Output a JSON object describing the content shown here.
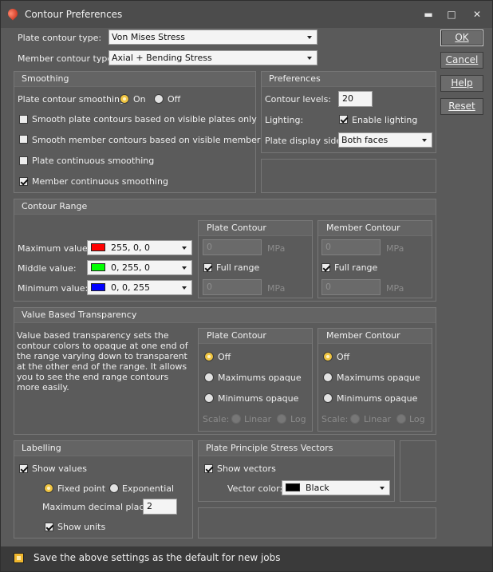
{
  "window": {
    "title": "Contour Preferences",
    "minimize": "▬",
    "maximize": "□",
    "close": "✕"
  },
  "top": {
    "plate_type_label": "Plate contour type:",
    "plate_type_value": "Von Mises Stress",
    "member_type_label": "Member contour type:",
    "member_type_value": "Axial + Bending Stress"
  },
  "buttons": {
    "ok": "OK",
    "cancel": "Cancel",
    "help": "Help",
    "reset": "Reset"
  },
  "smoothing": {
    "header": "Smoothing",
    "plate_smoothing_label": "Plate contour smoothing:",
    "on_label": "On",
    "off_label": "Off",
    "selected": "On",
    "options": [
      {
        "label": "Smooth plate contours based on visible plates only",
        "checked": false
      },
      {
        "label": "Smooth member contours based on visible members only",
        "checked": false
      },
      {
        "label": "Plate continuous smoothing",
        "checked": false
      },
      {
        "label": "Member continuous smoothing",
        "checked": true
      }
    ]
  },
  "preferences": {
    "header": "Preferences",
    "levels_label": "Contour levels:",
    "levels_value": "20",
    "lighting_label": "Lighting:",
    "enable_lighting_label": "Enable lighting",
    "enable_lighting": true,
    "display_side_label": "Plate display side:",
    "display_side_value": "Both faces"
  },
  "contour_range": {
    "header": "Contour Range",
    "max_label": "Maximum value:",
    "max_color": "255, 0, 0",
    "max_hex": "#ff0000",
    "mid_label": "Middle value:",
    "mid_color": "0, 255, 0",
    "mid_hex": "#00ff00",
    "min_label": "Minimum value:",
    "min_color": "0, 0, 255",
    "min_hex": "#0000ff",
    "plate": {
      "header": "Plate Contour",
      "max_value": "0",
      "unit": "MPa",
      "full_range_label": "Full range",
      "full_range": true,
      "min_value": "0"
    },
    "member": {
      "header": "Member Contour",
      "max_value": "0",
      "unit": "MPa",
      "full_range_label": "Full range",
      "full_range": true,
      "min_value": "0"
    }
  },
  "transparency": {
    "header": "Value Based Transparency",
    "description": "Value based transparency sets the contour colors to opaque at one end of the range varying down to transparent at the other end of the range. It allows you to see the end range contours more easily.",
    "plate": {
      "header": "Plate Contour",
      "off": "Off",
      "max_opaque": "Maximums opaque",
      "min_opaque": "Minimums opaque",
      "scale_label": "Scale:",
      "linear": "Linear",
      "log": "Log",
      "selected": "Off"
    },
    "member": {
      "header": "Member Contour",
      "off": "Off",
      "max_opaque": "Maximums opaque",
      "min_opaque": "Minimums opaque",
      "scale_label": "Scale:",
      "linear": "Linear",
      "log": "Log",
      "selected": "Off"
    }
  },
  "labelling": {
    "header": "Labelling",
    "show_values_label": "Show values",
    "show_values": true,
    "fixed_point_label": "Fixed point",
    "exponential_label": "Exponential",
    "selected": "Fixed point",
    "decimal_label": "Maximum decimal places:",
    "decimal_value": "2",
    "show_units_label": "Show units",
    "show_units": true
  },
  "vectors": {
    "header": "Plate Principle Stress Vectors",
    "show_vectors_label": "Show vectors",
    "show_vectors": true,
    "vector_color_label": "Vector color:",
    "vector_color": "Black",
    "vector_hex": "#000000"
  },
  "footer": {
    "save_default_label": "Save the above settings as the default for new jobs",
    "save_default": true
  }
}
